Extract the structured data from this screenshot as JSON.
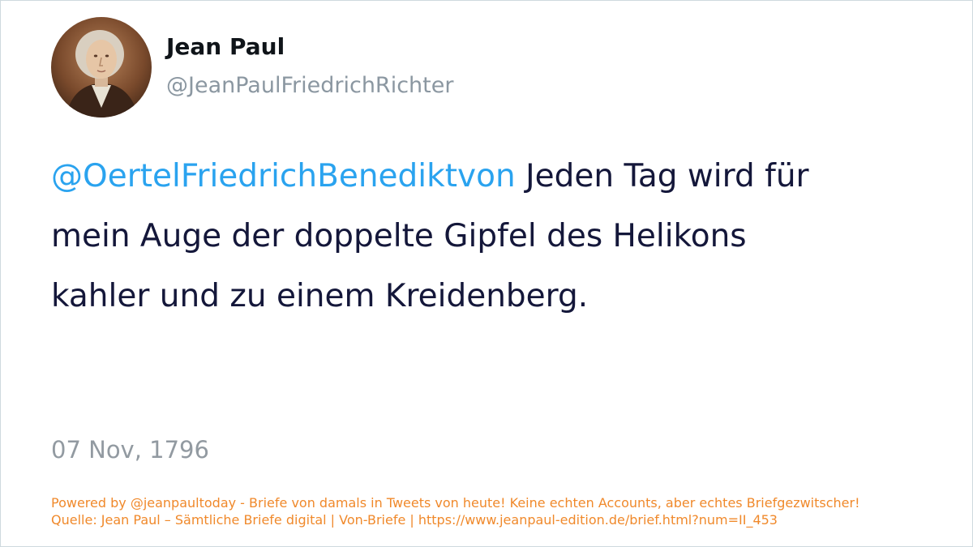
{
  "author": {
    "name": "Jean Paul",
    "handle": "@JeanPaulFriedrichRichter",
    "avatar_icon": "portrait-avatar"
  },
  "tweet": {
    "mention": "@OertelFriedrichBenediktvon",
    "text_after_mention": " Jeden Tag wird für mein Auge der doppelte Gipfel des Helikons kahler und zu einem Kreidenberg.",
    "date": "07 Nov, 1796"
  },
  "footer": {
    "powered_by": "Powered by @jeanpaultoday - Briefe von damals in Tweets von heute! Keine echten Accounts, aber echtes Briefgezwitscher!",
    "source": "Quelle: Jean Paul – Sämtliche Briefe digital | Von-Briefe | https://www.jeanpaul-edition.de/brief.html?num=II_453"
  },
  "colors": {
    "mention": "#2aa3ef",
    "text": "#14173a",
    "muted": "#929aa1",
    "footer": "#f0892b"
  }
}
